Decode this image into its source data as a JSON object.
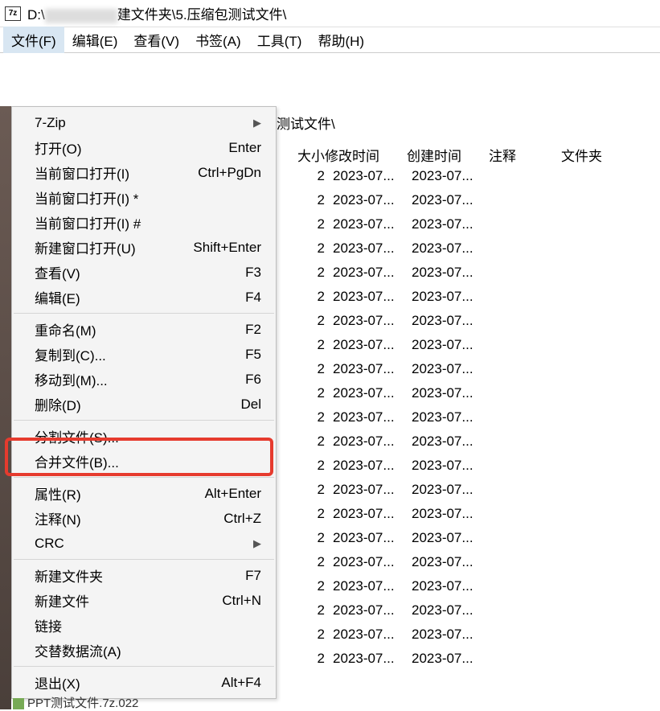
{
  "title": {
    "prefix": "D:\\",
    "suffix": "建文件夹\\5.压缩包测试文件\\",
    "icon_text": "7z"
  },
  "menubar": {
    "file": "文件(F)",
    "edit": "编辑(E)",
    "view": "查看(V)",
    "bookmark": "书签(A)",
    "tools": "工具(T)",
    "help": "帮助(H)"
  },
  "pathbar_fragment": "测试文件\\",
  "columns": {
    "size": "大小",
    "modified": "修改时间",
    "created": "创建时间",
    "comment": "注释",
    "folder": "文件夹"
  },
  "file_row": {
    "size": "2",
    "modified": "2023-07...",
    "created": "2023-07..."
  },
  "row_count": 21,
  "bottom_peek": "PPT测试文件.7z.022",
  "dropdown": {
    "items": [
      {
        "label": "7-Zip",
        "shortcut": "",
        "submenu": true
      },
      {
        "label": "打开(O)",
        "shortcut": "Enter"
      },
      {
        "label": "当前窗口打开(I)",
        "shortcut": "Ctrl+PgDn"
      },
      {
        "label": "当前窗口打开(I) *",
        "shortcut": ""
      },
      {
        "label": "当前窗口打开(I) #",
        "shortcut": ""
      },
      {
        "label": "新建窗口打开(U)",
        "shortcut": "Shift+Enter"
      },
      {
        "label": "查看(V)",
        "shortcut": "F3"
      },
      {
        "label": "编辑(E)",
        "shortcut": "F4"
      },
      {
        "sep": true
      },
      {
        "label": "重命名(M)",
        "shortcut": "F2"
      },
      {
        "label": "复制到(C)...",
        "shortcut": "F5"
      },
      {
        "label": "移动到(M)...",
        "shortcut": "F6"
      },
      {
        "label": "删除(D)",
        "shortcut": "Del"
      },
      {
        "sep": true
      },
      {
        "label": "分割文件(S)...",
        "shortcut": ""
      },
      {
        "label": "合并文件(B)...",
        "shortcut": "",
        "highlighted": true
      },
      {
        "sep": true
      },
      {
        "label": "属性(R)",
        "shortcut": "Alt+Enter"
      },
      {
        "label": "注释(N)",
        "shortcut": "Ctrl+Z"
      },
      {
        "label": "CRC",
        "shortcut": "",
        "submenu": true
      },
      {
        "sep": true
      },
      {
        "label": "新建文件夹",
        "shortcut": "F7"
      },
      {
        "label": "新建文件",
        "shortcut": "Ctrl+N"
      },
      {
        "label": "链接",
        "shortcut": ""
      },
      {
        "label": "交替数据流(A)",
        "shortcut": ""
      },
      {
        "sep": true
      },
      {
        "label": "退出(X)",
        "shortcut": "Alt+F4"
      }
    ]
  }
}
